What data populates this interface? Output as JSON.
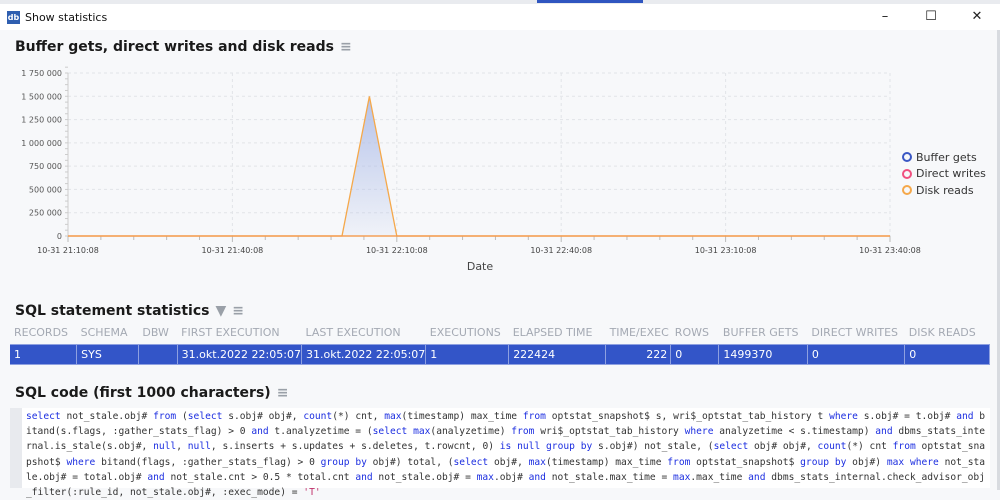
{
  "window": {
    "title": "Show statistics",
    "app_icon": "db",
    "buttons": [
      "–",
      "☐",
      "✕"
    ]
  },
  "chart_section": {
    "title": "Buffer gets, direct writes and disk reads"
  },
  "chart_data": {
    "type": "area",
    "title": "Buffer gets, direct writes and disk reads",
    "xlabel": "Date",
    "ylabel": "",
    "ylim": [
      0,
      1750000
    ],
    "yticks": [
      "0",
      "250 000",
      "500 000",
      "750 000",
      "1 000 000",
      "1 250 000",
      "1 500 000",
      "1 750 000"
    ],
    "xticks": [
      "10-31 21:10:08",
      "10-31 21:40:08",
      "10-31 22:10:08",
      "10-31 22:40:08",
      "10-31 23:10:08",
      "10-31 23:40:08"
    ],
    "x_minutes": [
      0,
      50,
      55,
      60,
      150
    ],
    "x_labels": [
      "10-31 21:10:08",
      "10-31 22:00:07",
      "10-31 22:05:07",
      "10-31 22:10:08",
      "10-31 23:40:08"
    ],
    "series": [
      {
        "name": "Buffer gets",
        "color": "#3a57c4",
        "values": [
          0,
          0,
          1499370,
          0,
          0
        ]
      },
      {
        "name": "Direct writes",
        "color": "#f0507f",
        "values": [
          0,
          0,
          0,
          0,
          0
        ]
      },
      {
        "name": "Disk reads",
        "color": "#f5a84a",
        "values": [
          0,
          0,
          0,
          0,
          0
        ]
      }
    ],
    "legend": "right",
    "grid": true
  },
  "stats": {
    "title": "SQL statement statistics",
    "columns": [
      "RECORDS",
      "SCHEMA",
      "DBW",
      "FIRST EXECUTION",
      "LAST EXECUTION",
      "EXECUTIONS",
      "ELAPSED TIME",
      "TIME/EXEC",
      "ROWS",
      "BUFFER GETS",
      "DIRECT WRITES",
      "DISK READS"
    ],
    "rows": [
      [
        "1",
        "SYS",
        "",
        "31.okt.2022 22:05:07",
        "31.okt.2022 22:05:07",
        "1",
        "222424",
        "222",
        "0",
        "1499370",
        "0",
        "0"
      ]
    ]
  },
  "sql": {
    "title": "SQL code (first 1000 characters)",
    "code": "select not_stale.obj# from (select s.obj# obj#, count(*) cnt, max(timestamp) max_time from optstat_snapshot$ s, wri$_optstat_tab_history t where s.obj# = t.obj# and bitand(s.flags, :gather_stats_flag) > 0 and t.analyzetime = (select max(analyzetime) from wri$_optstat_tab_history where analyzetime < s.timestamp) and dbms_stats_internal.is_stale(s.obj#, null, null, s.inserts + s.updates + s.deletes, t.rowcnt, 0) is null group by s.obj#) not_stale, (select obj# obj#, count(*) cnt from optstat_snapshot$ where bitand(flags, :gather_stats_flag) > 0 group by obj#) total, (select obj#, max(timestamp) max_time from optstat_snapshot$ group by obj#) max where not_stale.obj# = total.obj# and not_stale.cnt > 0.5 * total.cnt and not_stale.obj# = max.obj# and not_stale.max_time = max.max_time and dbms_stats_internal.check_advisor_obj_filter(:rule_id, not_stale.obj#, :exec_mode) = 'T'"
  }
}
